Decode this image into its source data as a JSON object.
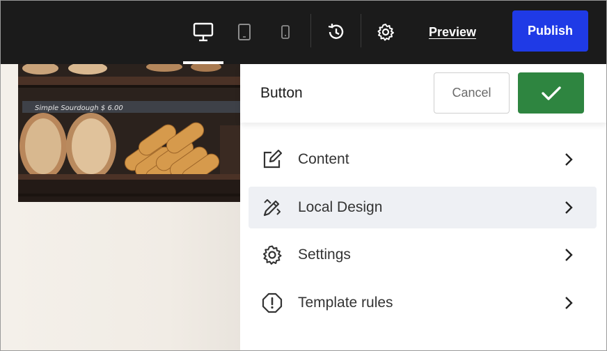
{
  "toolbar": {
    "preview_label": "Preview",
    "publish_label": "Publish",
    "devices": [
      {
        "icon": "desktop-icon",
        "active": true
      },
      {
        "icon": "tablet-icon",
        "active": false
      },
      {
        "icon": "mobile-icon",
        "active": false
      }
    ],
    "history_icon": "history-icon",
    "settings_icon": "gear-icon"
  },
  "canvas": {
    "image_sign_text": "Simple Sourdough $ 6.00"
  },
  "panel": {
    "title": "Button",
    "cancel_label": "Cancel",
    "confirm_icon": "check-icon",
    "menu": [
      {
        "label": "Content",
        "icon": "edit-icon",
        "active": false
      },
      {
        "label": "Local Design",
        "icon": "brush-icon",
        "active": true
      },
      {
        "label": "Settings",
        "icon": "gear-icon",
        "active": false
      },
      {
        "label": "Template rules",
        "icon": "alert-icon",
        "active": false
      }
    ]
  },
  "colors": {
    "topbar": "#1b1b1b",
    "publish": "#1f3ae6",
    "confirm": "#2e8540",
    "active_item": "#eef0f4"
  }
}
